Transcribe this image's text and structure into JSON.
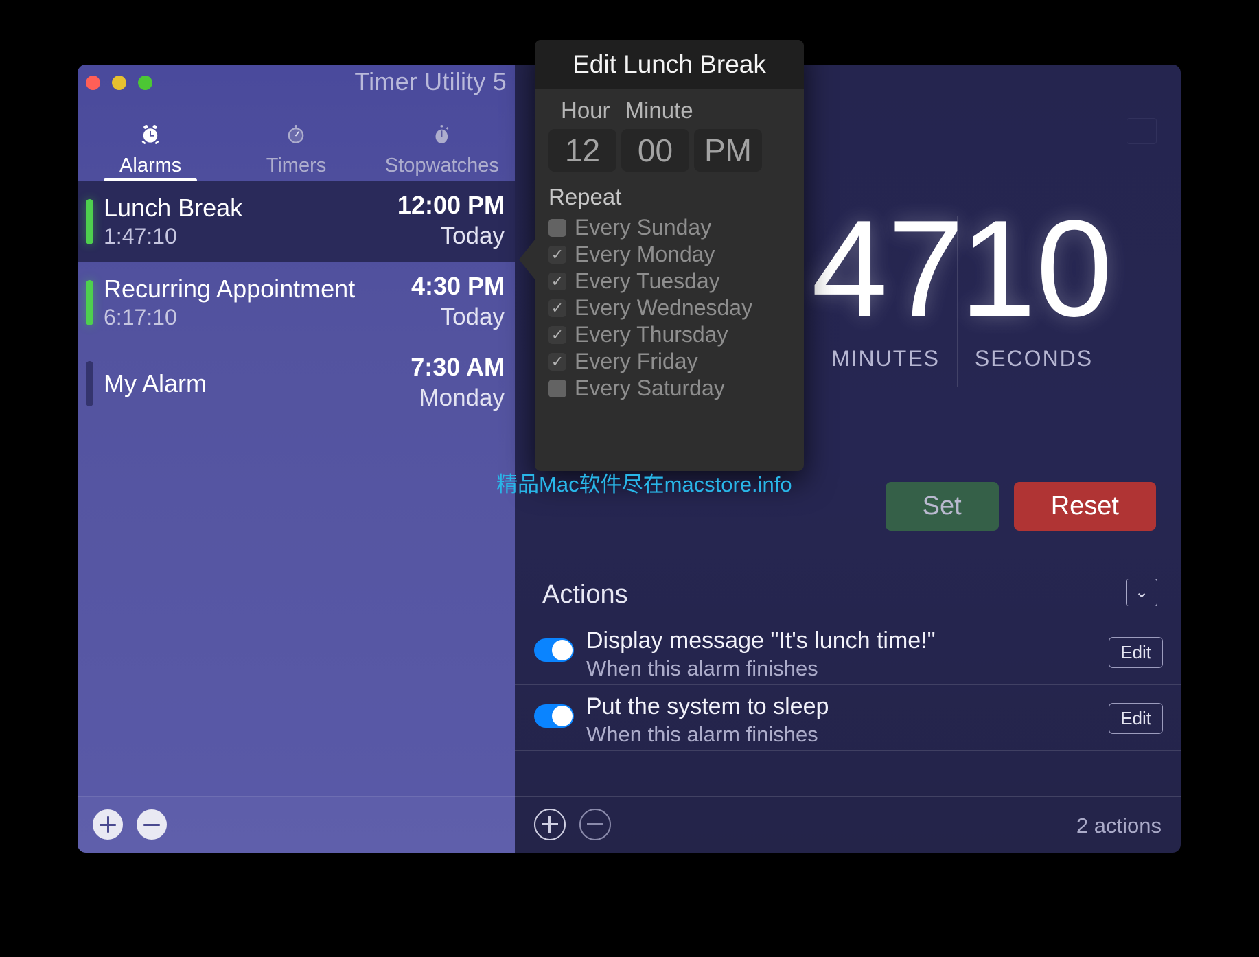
{
  "window": {
    "title": "Timer Utility 5",
    "traffic_lights": {
      "close": "#ff5f57",
      "minimize": "#e6c02f",
      "maximize": "#4cc734"
    }
  },
  "tabs": [
    {
      "label": "Alarms",
      "icon": "alarm-clock-icon",
      "glyph": "⏰",
      "active": true
    },
    {
      "label": "Timers",
      "icon": "timer-icon",
      "glyph": "🕐",
      "active": false
    },
    {
      "label": "Stopwatches",
      "icon": "stopwatch-icon",
      "glyph": "⏱",
      "active": false
    }
  ],
  "alarms": [
    {
      "name": "Lunch Break",
      "countdown": "1:47:10",
      "time": "12:00 PM",
      "day": "Today",
      "enabled": true,
      "selected": true
    },
    {
      "name": "Recurring Appointment",
      "countdown": "6:17:10",
      "time": "4:30 PM",
      "day": "Today",
      "enabled": true,
      "selected": false
    },
    {
      "name": "My Alarm",
      "countdown": "",
      "time": "7:30 AM",
      "day": "Monday",
      "enabled": false,
      "selected": false
    }
  ],
  "left_footer": {
    "add_label": "+",
    "remove_label": "−"
  },
  "countdown": {
    "units": [
      {
        "value": "47",
        "caption": "MINUTES"
      },
      {
        "value": "10",
        "caption": "SECONDS"
      }
    ]
  },
  "buttons": {
    "set": "Set",
    "reset": "Reset"
  },
  "actions_section": {
    "title": "Actions",
    "collapse_glyph": "⌄",
    "rows": [
      {
        "title": "Display message \"It's lunch time!\"",
        "subtitle": "When this alarm finishes",
        "enabled": true,
        "edit_label": "Edit"
      },
      {
        "title": "Put the system to sleep",
        "subtitle": "When this alarm finishes",
        "enabled": true,
        "edit_label": "Edit"
      }
    ],
    "count_label": "2 actions"
  },
  "right_footer": {
    "add_label": "+",
    "remove_label": "−"
  },
  "popover": {
    "title": "Edit Lunch Break",
    "hour_label": "Hour",
    "minute_label": "Minute",
    "hour_value": "12",
    "minute_value": "00",
    "meridiem_value": "PM",
    "repeat_label": "Repeat",
    "days": [
      {
        "label": "Every Sunday",
        "checked": false
      },
      {
        "label": "Every Monday",
        "checked": true
      },
      {
        "label": "Every Tuesday",
        "checked": true
      },
      {
        "label": "Every Wednesday",
        "checked": true
      },
      {
        "label": "Every Thursday",
        "checked": true
      },
      {
        "label": "Every Friday",
        "checked": true
      },
      {
        "label": "Every Saturday",
        "checked": false
      }
    ],
    "check_glyph": "✓"
  },
  "watermark": {
    "text": "精品Mac软件尽在macstore.info",
    "color": "#29b6e8"
  },
  "colors": {
    "accent_green": "#4ed04e",
    "toggle_blue": "#0a84ff",
    "set_green": "#356048",
    "reset_red": "#b03434",
    "left_pane": "#53539f",
    "right_pane": "#262652",
    "popover_bg": "#2e2e2e"
  }
}
